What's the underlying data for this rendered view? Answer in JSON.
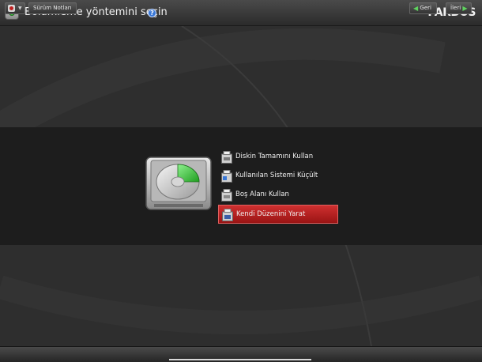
{
  "header": {
    "title": "Bölümleme yöntemini seçin",
    "brand": "PARDUS",
    "help_symbol": "?"
  },
  "options": [
    {
      "label": "Diskin Tamamını Kullan",
      "icon": "disk-full-icon",
      "selected": false
    },
    {
      "label": "Kullanılan Sistemi Küçült",
      "icon": "disk-shrink-icon",
      "selected": false
    },
    {
      "label": "Boş Alanı Kullan",
      "icon": "disk-free-space-icon",
      "selected": false
    },
    {
      "label": "Kendi Düzenini Yarat",
      "icon": "disk-custom-icon",
      "selected": true
    }
  ],
  "footer": {
    "release_notes": "Sürüm Notları",
    "back": "Geri",
    "next": "İleri"
  },
  "colors": {
    "selected": "#b51f1f",
    "accent_green": "#3fbf3f"
  }
}
